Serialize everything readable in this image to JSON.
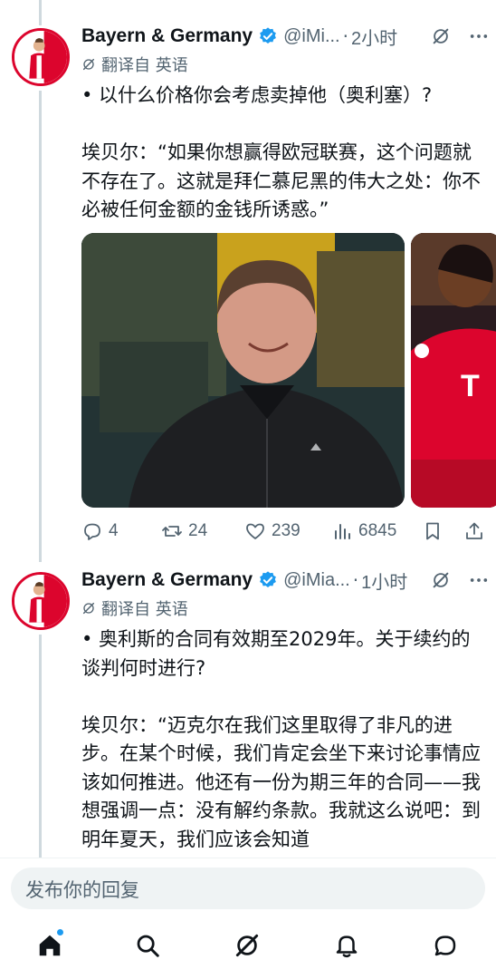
{
  "tweets": [
    {
      "author_name": "Bayern & Germany",
      "handle": "@iMi...",
      "separator": "·",
      "time": "2小时",
      "translated_label": "翻译自 英语",
      "text": "• 以什么价格你会考虑卖掉他（奥利塞）?\n\n埃贝尔：“如果你想赢得欧冠联赛，这个问题就不存在了。这就是拜仁慕尼黑的伟大之处：你不必被任何金额的金钱所诱惑。”",
      "stats": {
        "replies": "4",
        "reposts": "24",
        "likes": "239",
        "views": "6845"
      }
    },
    {
      "author_name": "Bayern & Germany",
      "handle": "@iMia...",
      "separator": "·",
      "time": "1小时",
      "translated_label": "翻译自 英语",
      "text": "• 奥利斯的合同有效期至2029年。关于续约的谈判何时进行?\n\n埃贝尔：“迈克尔在我们这里取得了非凡的进步。在某个时候，我们肯定会坐下来讨论事情应该如何推进。他还有一份为期三年的合同——我想强调一点：没有解约条款。我就这么说吧：到明年夏天，我们应该会知道"
    }
  ],
  "reply_bar": {
    "placeholder": "发布你的回复"
  },
  "tabs": [
    "home",
    "search",
    "grok",
    "notifications",
    "messages"
  ],
  "colors": {
    "accent": "#1d9bf0",
    "text": "#0f1419",
    "secondary": "#536471",
    "bayern_red": "#dc052d"
  }
}
